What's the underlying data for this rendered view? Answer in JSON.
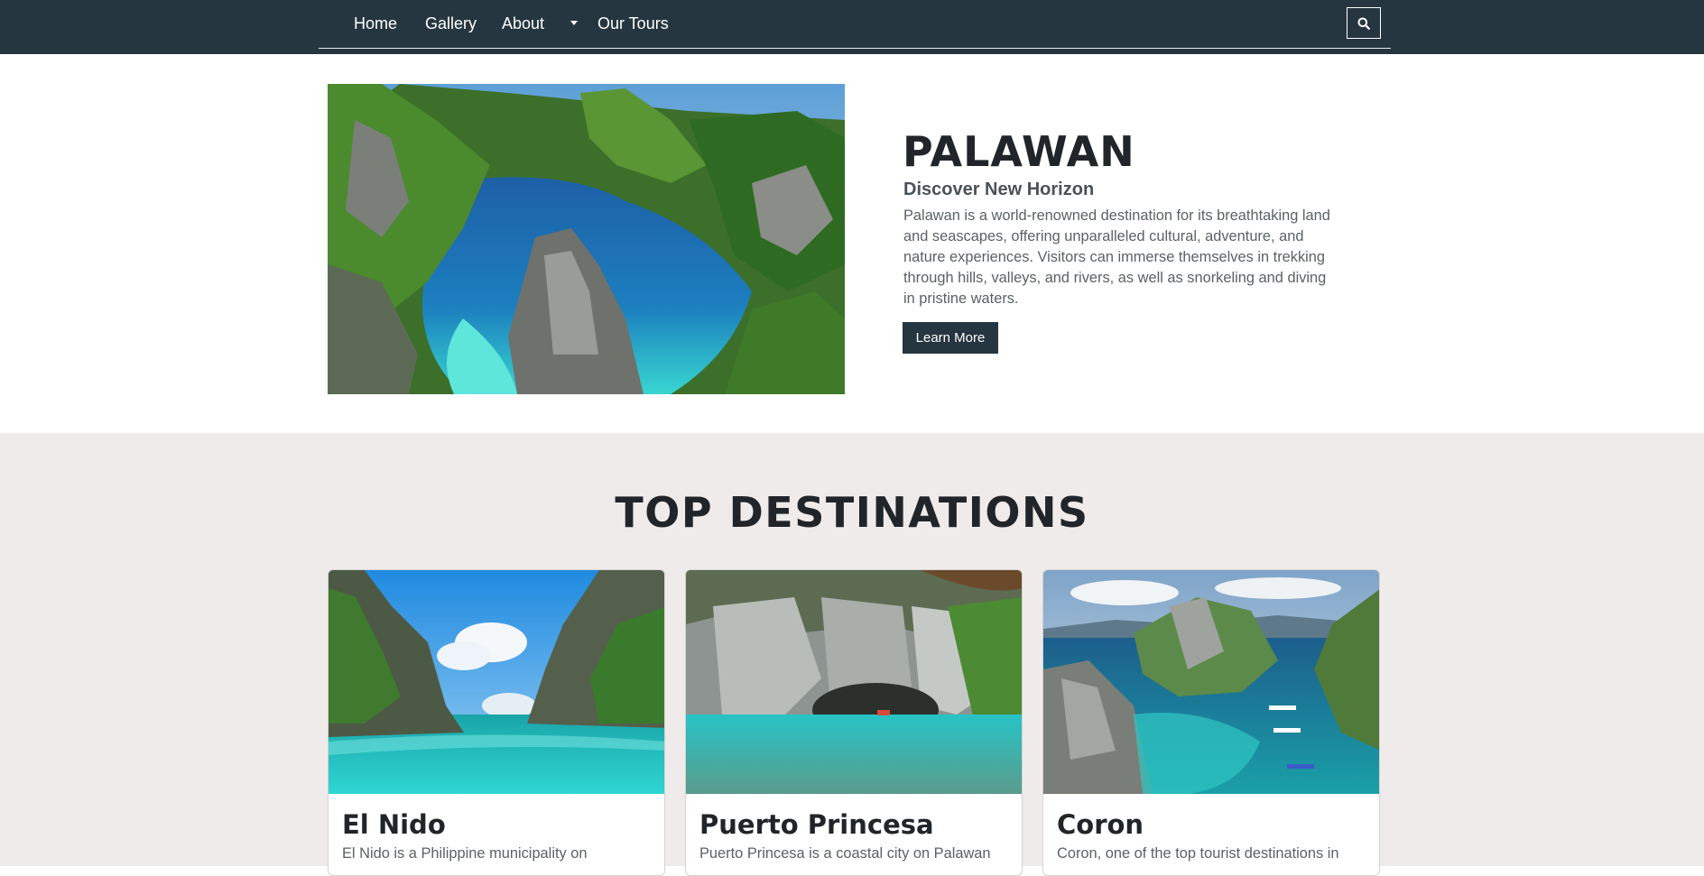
{
  "nav": {
    "items": [
      {
        "label": "Home"
      },
      {
        "label": "Gallery"
      },
      {
        "label": "About"
      },
      {
        "label": "Our Tours"
      }
    ],
    "dropdown_icon": "caret-down-icon",
    "search_icon": "search-icon",
    "background": "#263640"
  },
  "hero": {
    "title": "PALAWAN",
    "subtitle": "Discover New Horizon",
    "description": "Palawan is a world-renowned destination for its breathtaking land and seascapes, offering unparalleled cultural, adventure, and nature experiences. Visitors can immerse themselves in trekking through hills, valleys, and rivers, as well as snorkeling and diving in pristine waters.",
    "button_label": "Learn More"
  },
  "destinations": {
    "heading": "TOP DESTINATIONS",
    "cards": [
      {
        "title": "El Nido",
        "text": "El Nido is a Philippine municipality on"
      },
      {
        "title": "Puerto Princesa",
        "text": "Puerto Princesa is a coastal city on Palawan"
      },
      {
        "title": "Coron",
        "text": "Coron, one of the top tourist destinations in"
      }
    ],
    "background": "#efebea"
  }
}
